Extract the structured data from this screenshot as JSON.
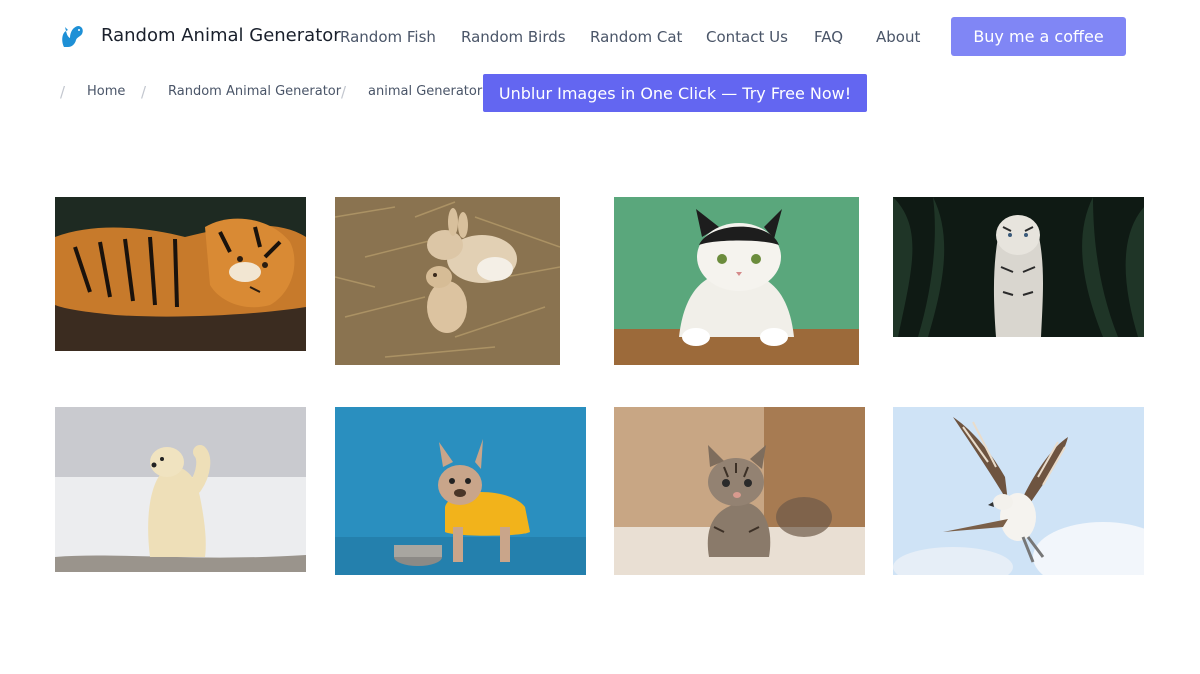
{
  "header": {
    "brand": "Random Animal Generator",
    "logo_icon": "squirrel-logo-icon",
    "accent": "#1e90d6",
    "nav": [
      {
        "label": "Random Fish"
      },
      {
        "label": "Random Birds"
      },
      {
        "label": "Random Cat"
      },
      {
        "label": "Contact Us"
      },
      {
        "label": "FAQ"
      },
      {
        "label": "About"
      }
    ],
    "cta_label": "Buy me a coffee",
    "cta_color": "#8086f5"
  },
  "breadcrumb": {
    "items": [
      "Home",
      "Random Animal Generator",
      "animal Generator"
    ],
    "separator": "/"
  },
  "promo": {
    "label": "Unblur Images in One Click — Try Free Now!",
    "color": "#6366f1"
  },
  "gallery": {
    "images": [
      {
        "subject": "tiger lying down"
      },
      {
        "subject": "rabbits on straw"
      },
      {
        "subject": "black and white cat"
      },
      {
        "subject": "white tiger in jungle"
      },
      {
        "subject": "polar bear waving"
      },
      {
        "subject": "french bulldog in yellow shirt"
      },
      {
        "subject": "tabby kitten"
      },
      {
        "subject": "osprey in flight"
      }
    ]
  }
}
